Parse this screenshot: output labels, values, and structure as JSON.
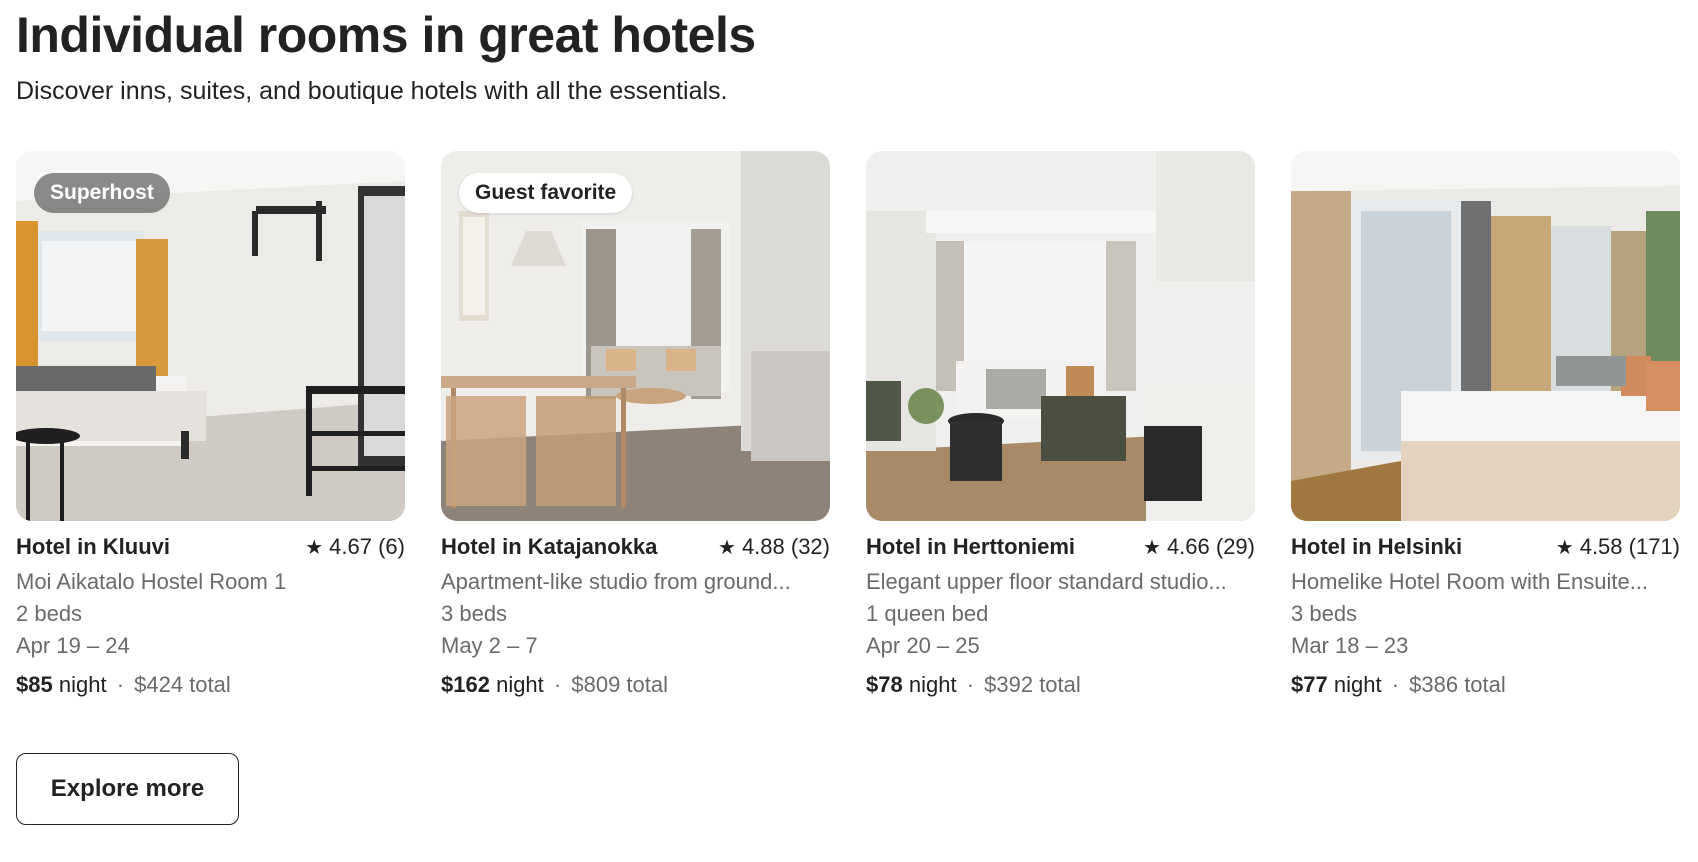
{
  "section": {
    "title": "Individual rooms in great hotels",
    "subtitle": "Discover inns, suites, and boutique hotels with all the essentials."
  },
  "cards": [
    {
      "badge": "Superhost",
      "title": "Hotel in Kluuvi",
      "rating": "4.67 (6)",
      "name": "Moi Aikatalo Hostel Room 1",
      "beds": "2 beds",
      "dates": "Apr 19 – 24",
      "price": "$85",
      "price_unit": "night",
      "separator": "·",
      "total": "$424 total"
    },
    {
      "badge": "Guest favorite",
      "title": "Hotel in Katajanokka",
      "rating": "4.88 (32)",
      "name": "Apartment-like studio from ground...",
      "beds": "3 beds",
      "dates": "May 2 – 7",
      "price": "$162",
      "price_unit": "night",
      "separator": "·",
      "total": "$809 total"
    },
    {
      "badge": "",
      "title": "Hotel in Herttoniemi",
      "rating": "4.66 (29)",
      "name": "Elegant upper floor standard studio...",
      "beds": "1 queen bed",
      "dates": "Apr 20 – 25",
      "price": "$78",
      "price_unit": "night",
      "separator": "·",
      "total": "$392 total"
    },
    {
      "badge": "",
      "title": "Hotel in Helsinki",
      "rating": "4.58 (171)",
      "name": "Homelike Hotel Room with Ensuite...",
      "beds": "3 beds",
      "dates": "Mar 18 – 23",
      "price": "$77",
      "price_unit": "night",
      "separator": "·",
      "total": "$386 total"
    }
  ],
  "explore_label": "Explore more",
  "icons": {
    "rating": "star-icon"
  },
  "colors": {
    "text": "#222222",
    "muted": "#6a6a6a"
  }
}
